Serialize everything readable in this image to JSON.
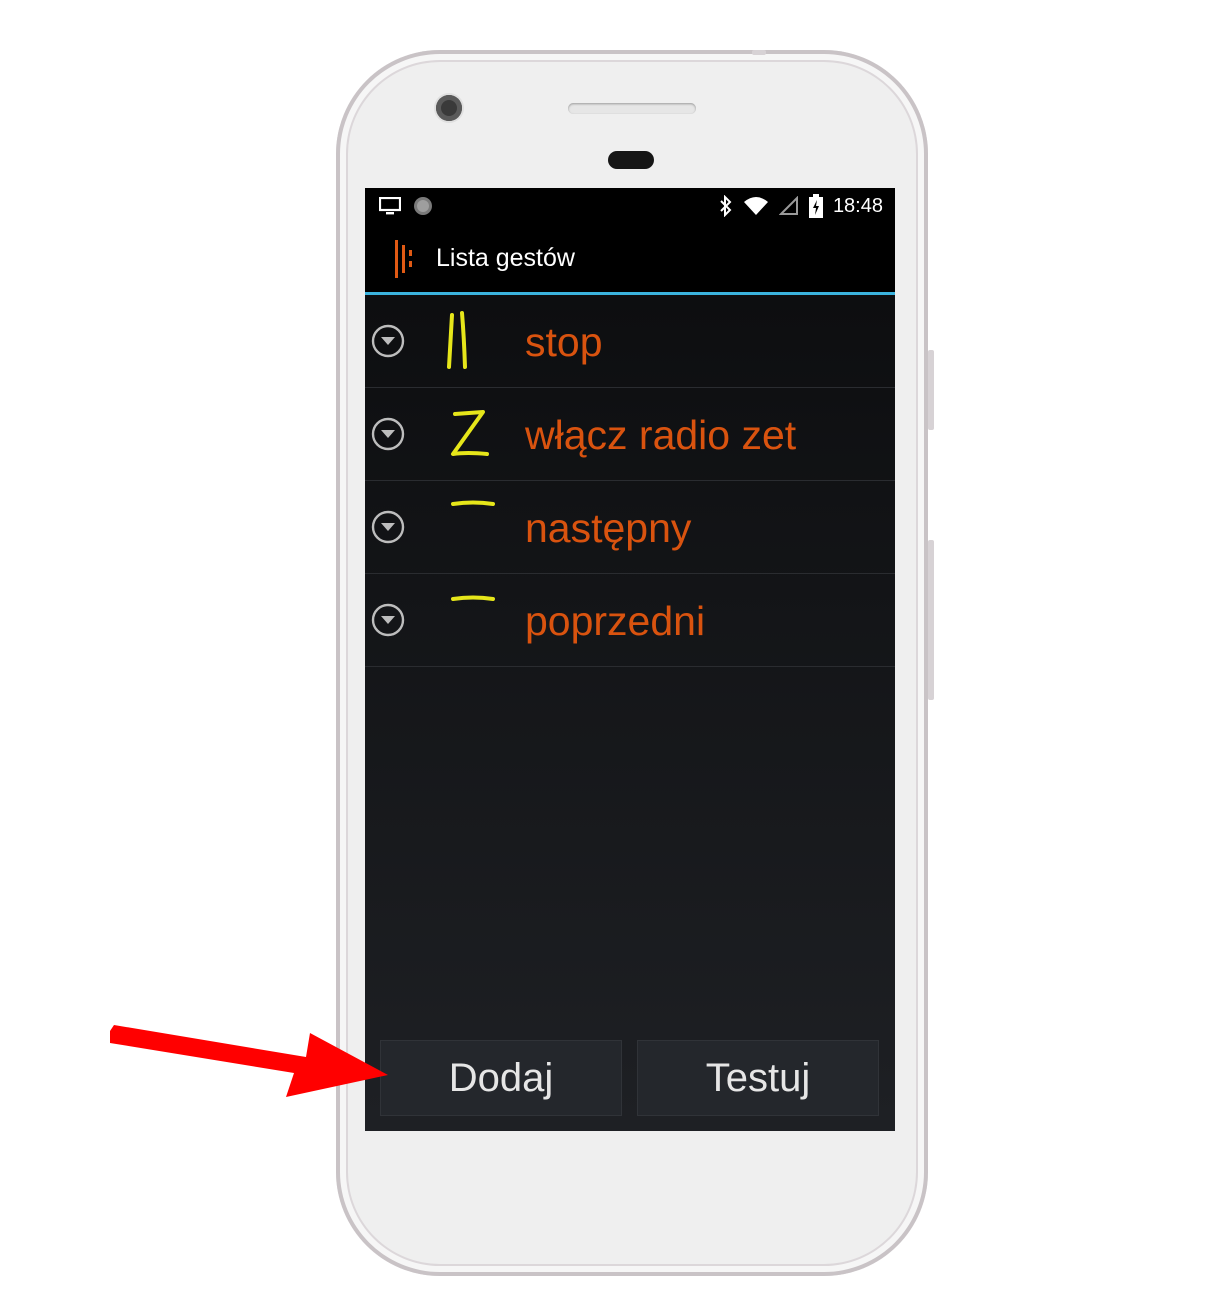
{
  "status_bar": {
    "time": "18:48",
    "icons": [
      "screen-cast-icon",
      "circle-notification-icon",
      "bluetooth-icon",
      "wifi-icon",
      "signal-icon",
      "battery-charging-icon"
    ]
  },
  "action_bar": {
    "title": "Lista gestów",
    "app_icon": "gesture-app-icon",
    "accent_color": "#3bb3de"
  },
  "gestures": [
    {
      "label": "stop",
      "shape": "double-vertical-lines"
    },
    {
      "label": "włącz radio zet",
      "shape": "letter-z"
    },
    {
      "label": "następny",
      "shape": "horizontal-line"
    },
    {
      "label": "poprzedni",
      "shape": "horizontal-line"
    }
  ],
  "buttons": {
    "add": "Dodaj",
    "test": "Testuj"
  },
  "colors": {
    "label": "#d9530f",
    "gesture_stroke": "#e6e61a",
    "arrow": "#ff0000"
  }
}
